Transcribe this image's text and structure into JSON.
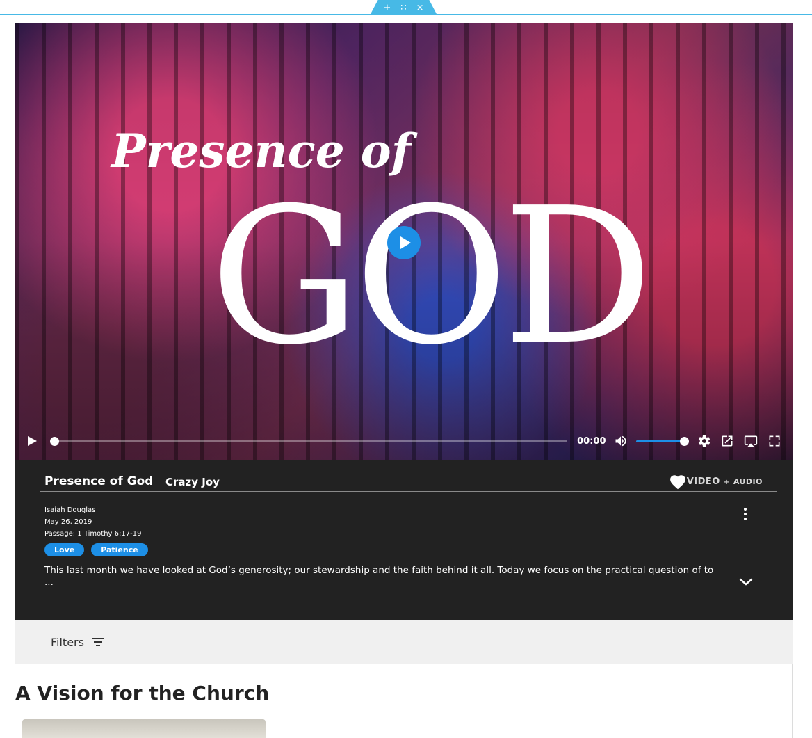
{
  "editor_bar": {
    "add_glyph": "+",
    "move_glyph": "∷",
    "close_glyph": "×"
  },
  "video": {
    "artwork_title_small": "Presence of",
    "artwork_title_big": "GOD",
    "time": "00:00",
    "progress": 0,
    "volume": 1.0
  },
  "sermon": {
    "title": "Presence of God",
    "series": "Crazy Joy",
    "media_video": "VIDEO",
    "media_plus": "+",
    "media_audio": "AUDIO",
    "speaker": "Isaiah Douglas",
    "date": "May 26, 2019",
    "passage": "Passage: 1 Timothy 6:17-19",
    "tags": [
      "Love",
      "Patience"
    ],
    "description": "This last month we have looked at God’s generosity; our stewardship and the faith behind it all. Today we focus on the practical question of to ..."
  },
  "filters": {
    "label": "Filters"
  },
  "section": {
    "title": "A Vision for the Church"
  },
  "colors": {
    "accent": "#1d8fe6",
    "editor": "#47b9e6",
    "panel": "#222222"
  }
}
